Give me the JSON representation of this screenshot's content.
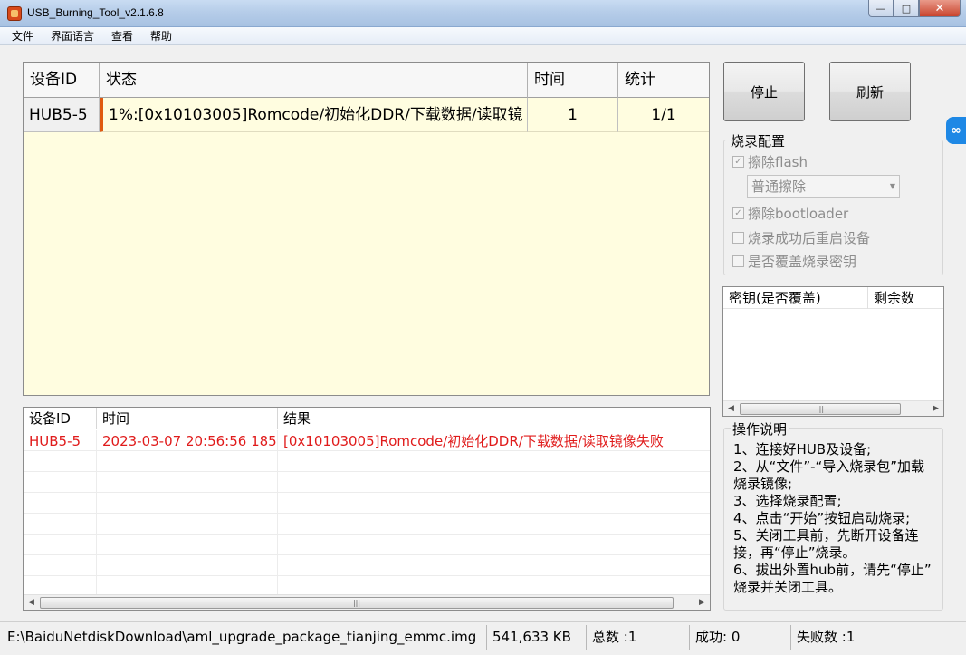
{
  "window": {
    "title": "USB_Burning_Tool_v2.1.6.8"
  },
  "menu": [
    "文件",
    "界面语言",
    "查看",
    "帮助"
  ],
  "device_table": {
    "headers": [
      "设备ID",
      "状态",
      "时间",
      "统计"
    ],
    "rows": [
      {
        "id": "HUB5-5",
        "status": "1%:[0x10103005]Romcode/初始化DDR/下载数据/读取镜",
        "time": "1",
        "stat": "1/1"
      }
    ]
  },
  "log_table": {
    "headers": [
      "设备ID",
      "时间",
      "结果"
    ],
    "rows": [
      {
        "id": "HUB5-5",
        "time": "2023-03-07 20:56:56 185",
        "result": "[0x10103005]Romcode/初始化DDR/下载数据/读取镜像失败"
      }
    ]
  },
  "buttons": {
    "stop": "停止",
    "refresh": "刷新"
  },
  "burn_config": {
    "title": "烧录配置",
    "erase_flash": "擦除flash",
    "erase_mode": "普通擦除",
    "erase_bootloader": "擦除bootloader",
    "reboot_after_success": "烧录成功后重启设备",
    "overwrite_keys": "是否覆盖烧录密钥"
  },
  "key_list": {
    "headers": [
      "密钥(是否覆盖)",
      "剩余数"
    ]
  },
  "instructions": {
    "title": "操作说明",
    "lines": [
      "1、连接好HUB及设备;",
      "2、从“文件”-“导入烧录包”加载",
      "烧录镜像;",
      "3、选择烧录配置;",
      "4、点击“开始”按钮启动烧录;",
      "5、关闭工具前，先断开设备连",
      "接，再“停止”烧录。",
      "6、拔出外置hub前，请先“停止”",
      "烧录并关闭工具。"
    ]
  },
  "status_bar": {
    "file_path": "E:\\BaiduNetdiskDownload\\aml_upgrade_package_tianjing_emmc.img",
    "file_size": "541,633 KB",
    "total": "总数 :1",
    "success": "成功: 0",
    "failed": "失败数 :1"
  },
  "colors": {
    "table_bg": "#fffde0",
    "error_text": "#e01b1b",
    "progress_accent": "#e05a10"
  }
}
